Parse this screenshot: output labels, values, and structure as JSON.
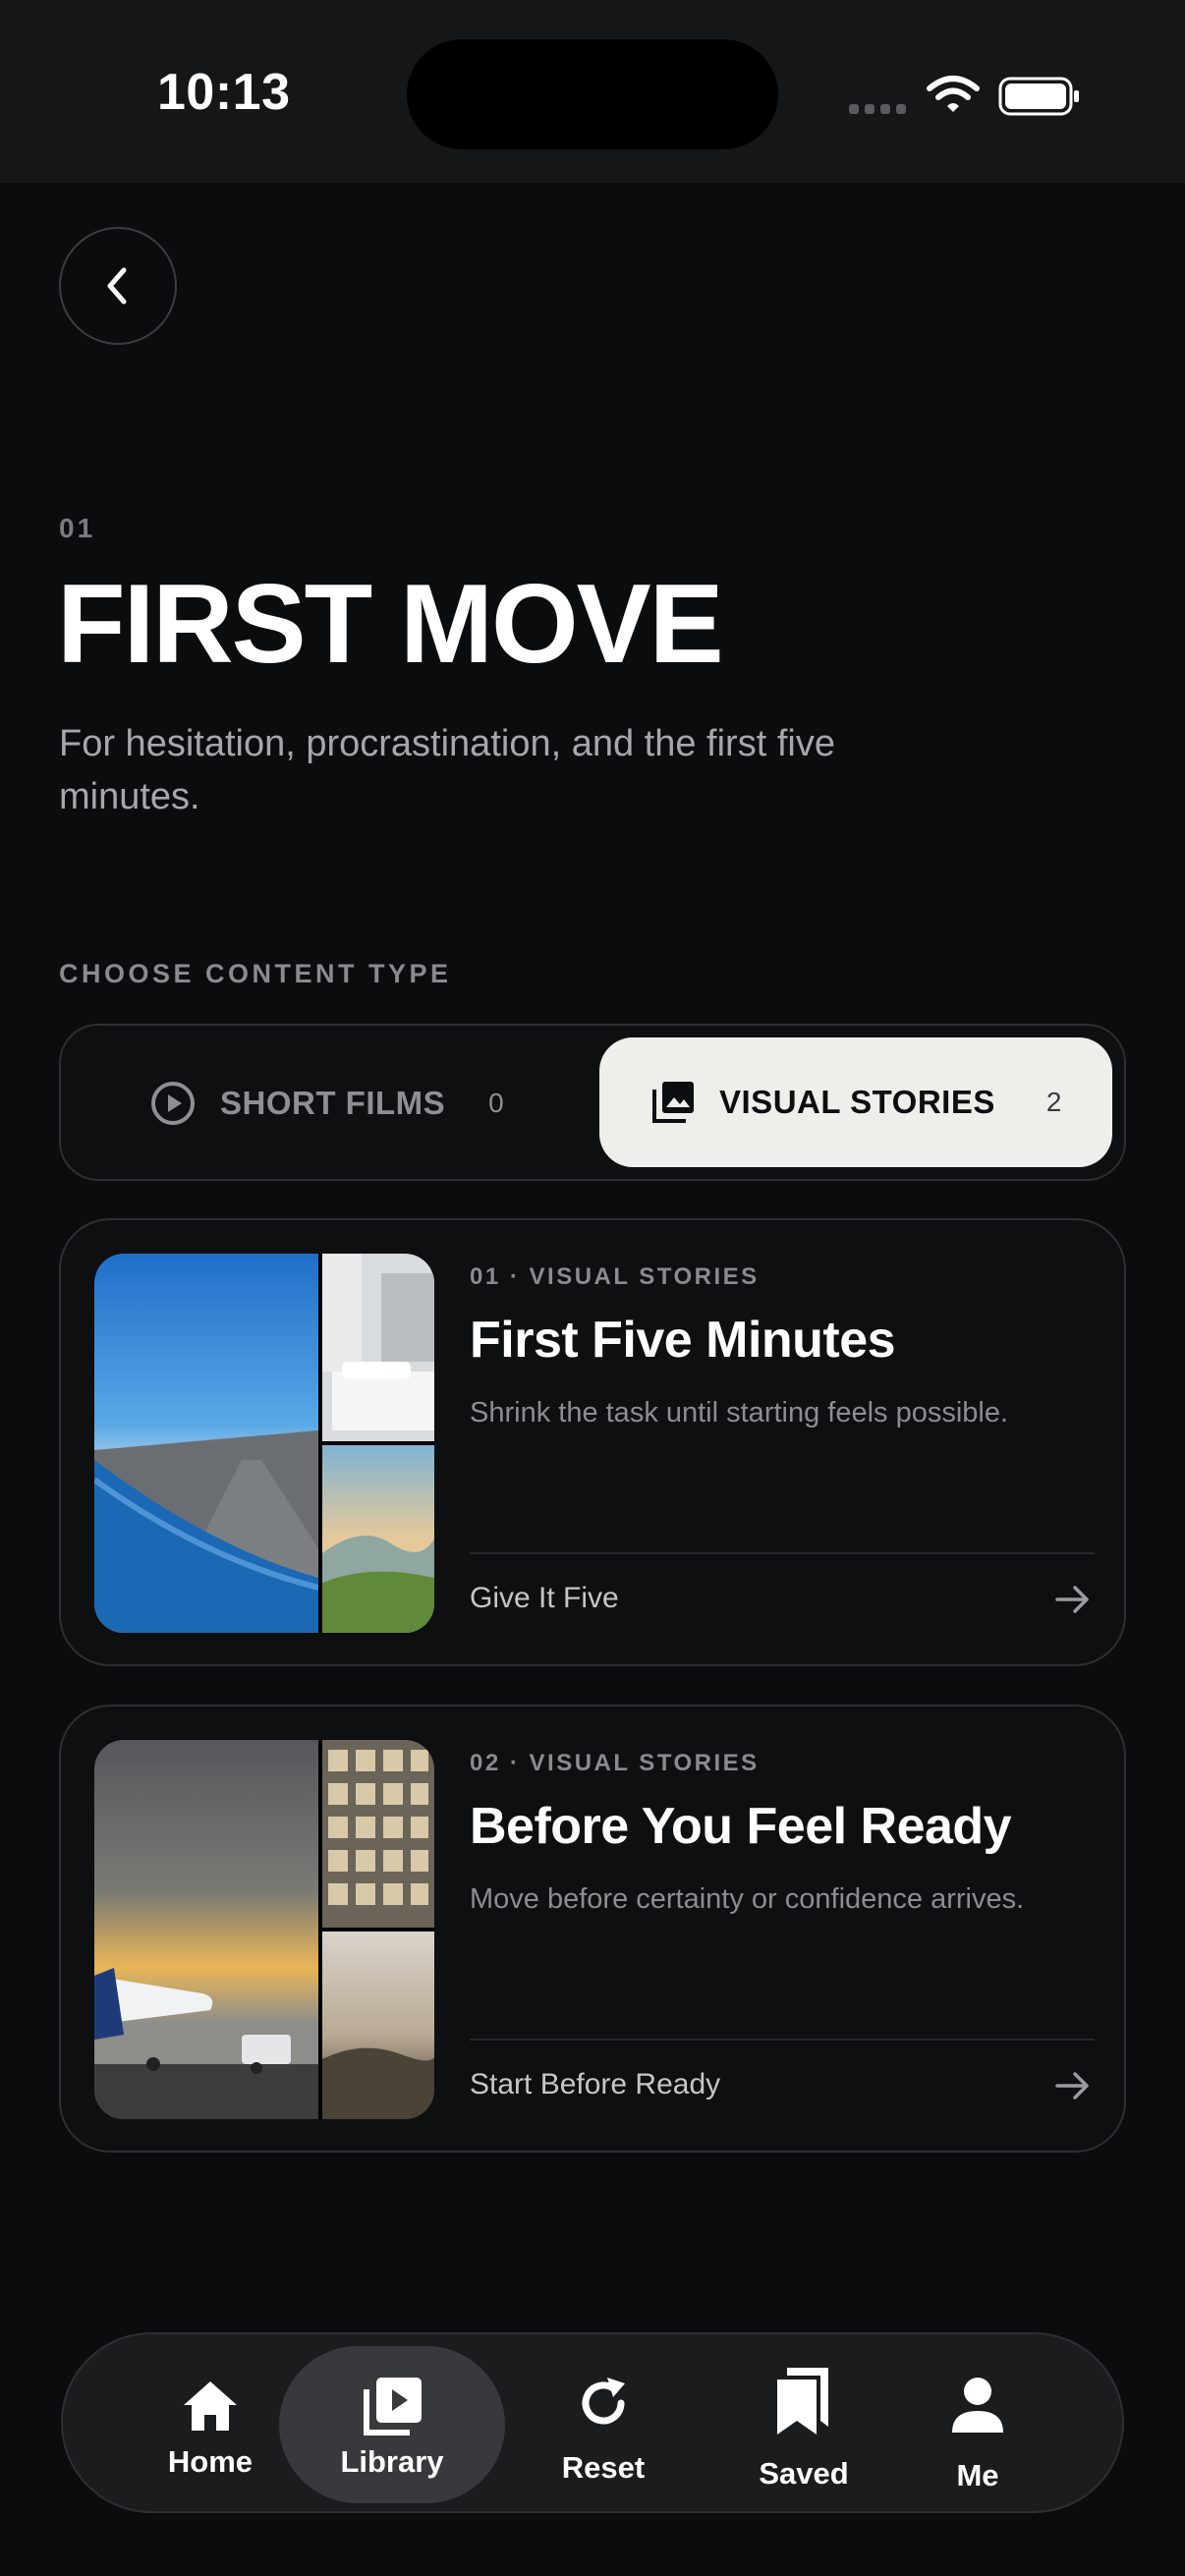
{
  "status_bar": {
    "time": "10:13"
  },
  "header": {
    "section_number": "01",
    "title": "FIRST MOVE",
    "subtitle": "For hesitation, procrastination, and the first five minutes."
  },
  "content_type": {
    "label": "CHOOSE CONTENT TYPE",
    "tabs": [
      {
        "label": "SHORT FILMS",
        "count": "0",
        "icon": "play-circle-icon",
        "selected": false
      },
      {
        "label": "VISUAL STORIES",
        "count": "2",
        "icon": "gallery-icon",
        "selected": true
      }
    ]
  },
  "stories": [
    {
      "kicker": "01 · VISUAL STORIES",
      "title": "First Five Minutes",
      "description": "Shrink the task until starting feels possible.",
      "action": "Give It Five"
    },
    {
      "kicker": "02 · VISUAL STORIES",
      "title": "Before You Feel Ready",
      "description": "Move before certainty or confidence arrives.",
      "action": "Start Before Ready"
    }
  ],
  "tab_bar": {
    "items": [
      {
        "label": "Home",
        "icon": "home-icon",
        "active": false
      },
      {
        "label": "Library",
        "icon": "library-icon",
        "active": true
      },
      {
        "label": "Reset",
        "icon": "refresh-icon",
        "active": false
      },
      {
        "label": "Saved",
        "icon": "bookmark-icon",
        "active": false
      },
      {
        "label": "Me",
        "icon": "person-icon",
        "active": false
      }
    ]
  },
  "colors": {
    "background": "#0b0c0e",
    "card_border": "#2e2f32",
    "selected_segment": "#eeefeb",
    "muted_text": "#8a8b8e"
  }
}
